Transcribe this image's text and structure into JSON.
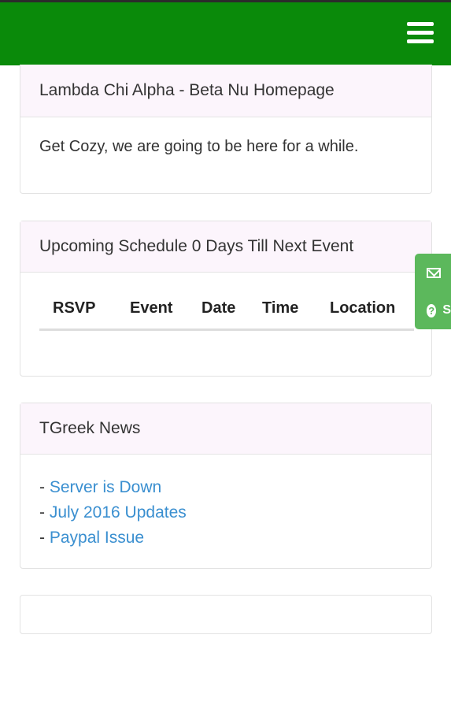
{
  "colors": {
    "navbar": "#0a8a0a",
    "panel_heading_bg": "#fcf5fc",
    "link": "#3a8fd0",
    "side_widget": "#5cb85c"
  },
  "navbar": {
    "menu_icon": "hamburger-menu-icon"
  },
  "homepage_panel": {
    "title": "Lambda Chi Alpha - Beta Nu Homepage",
    "body": "Get Cozy, we are going to be here for a while."
  },
  "schedule_panel": {
    "title": "Upcoming Schedule 0 Days Till Next Event",
    "columns": [
      "RSVP",
      "Event",
      "Date",
      "Time",
      "Location"
    ]
  },
  "news_panel": {
    "title": "TGreek News",
    "items": [
      {
        "prefix": "- ",
        "label": "Server is Down"
      },
      {
        "prefix": "- ",
        "label": "July 2016 Updates"
      },
      {
        "prefix": "- ",
        "label": "Paypal Issue"
      }
    ]
  },
  "side_widget": {
    "mail_icon": "envelope-icon",
    "help_icon": "question-circle-icon",
    "help_glyph": "?",
    "help_text": "S"
  }
}
